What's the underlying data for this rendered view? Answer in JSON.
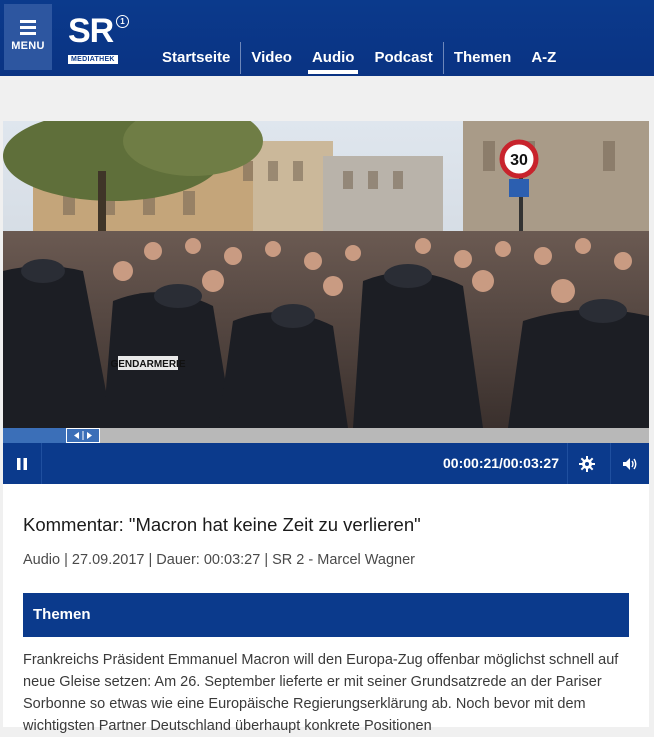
{
  "header": {
    "menu_label": "MENU",
    "logo_text": "SR",
    "logo_sub": "MEDIATHEK",
    "logo_badge": "1",
    "nav": [
      {
        "label": "Startseite",
        "active": false
      },
      {
        "label": "Video",
        "active": false
      },
      {
        "label": "Audio",
        "active": true
      },
      {
        "label": "Podcast",
        "active": false
      },
      {
        "label": "Themen",
        "active": false
      },
      {
        "label": "A-Z",
        "active": false
      }
    ]
  },
  "player": {
    "image_alt": "Gendarmerie vor Menschenmenge in Paris",
    "helmet_text": "GENDARMERIE",
    "sign_value": "30",
    "progress": 0.1,
    "time_display": "00:00:21/00:03:27",
    "icons": [
      "pause-icon",
      "gear-icon",
      "volume-icon"
    ]
  },
  "article": {
    "title": "Kommentar: \"Macron hat keine Zeit zu verlieren\"",
    "meta": "Audio | 27.09.2017 | Dauer: 00:03:27 | SR 2 - Marcel Wagner",
    "themes_label": "Themen",
    "description": "Frankreichs Präsident Emmanuel Macron will den Europa-Zug offenbar möglichst schnell auf neue Gleise setzen: Am 26. September lieferte er mit seiner Grundsatzrede an der Pariser Sorbonne so etwas wie eine Europäische Regierungserklärung ab. Noch bevor mit dem wichtigsten Partner Deutschland überhaupt konkrete Positionen"
  },
  "colors": {
    "brand_blue": "#0b3a8c",
    "progress_blue": "#3b6fb8"
  }
}
